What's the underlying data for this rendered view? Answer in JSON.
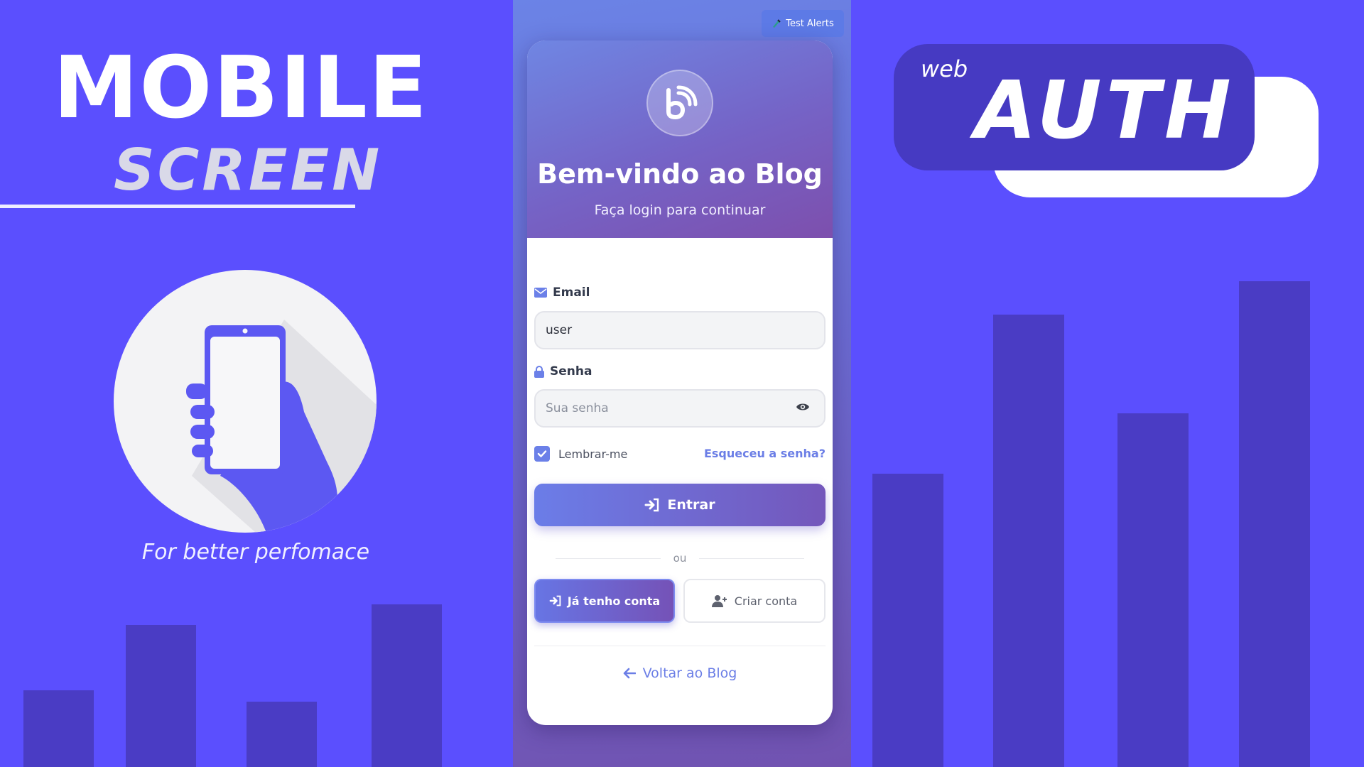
{
  "promo_left": {
    "title": "MOBILE",
    "subtitle": "SCREEN",
    "tagline": "For better perfomace"
  },
  "promo_right": {
    "small_label": "web",
    "big_label": "AUTH"
  },
  "toolbar": {
    "test_alerts_label": "Test Alerts"
  },
  "header": {
    "title": "Bem-vindo ao Blog",
    "subtitle": "Faça login para continuar"
  },
  "form": {
    "email_label": "Email",
    "email_value": "user",
    "password_label": "Senha",
    "password_placeholder": "Sua senha",
    "remember_label": "Lembrar-me",
    "remember_checked": true,
    "forgot_label": "Esqueceu a senha?",
    "submit_label": "Entrar",
    "divider_label": "ou",
    "have_account_label": "Já tenho conta",
    "create_account_label": "Criar conta",
    "back_label": "Voltar ao Blog"
  },
  "colors": {
    "background": "#5b4ffe",
    "bars": "#4a3cc4",
    "accent": "#6b7ee6",
    "badge": "#463ac2"
  }
}
